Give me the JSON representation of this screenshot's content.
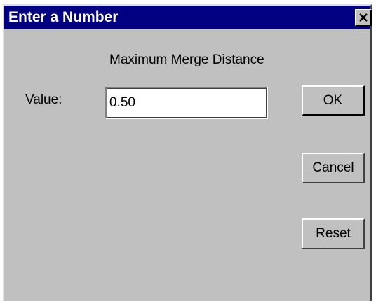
{
  "window": {
    "title": "Enter a Number",
    "close_icon": "close-icon"
  },
  "dialog": {
    "heading": "Maximum Merge Distance",
    "value_label": "Value:",
    "value": "0.50"
  },
  "buttons": {
    "ok": "OK",
    "cancel": "Cancel",
    "reset": "Reset"
  },
  "colors": {
    "titlebar": "#000080",
    "face": "#c0c0c0"
  }
}
